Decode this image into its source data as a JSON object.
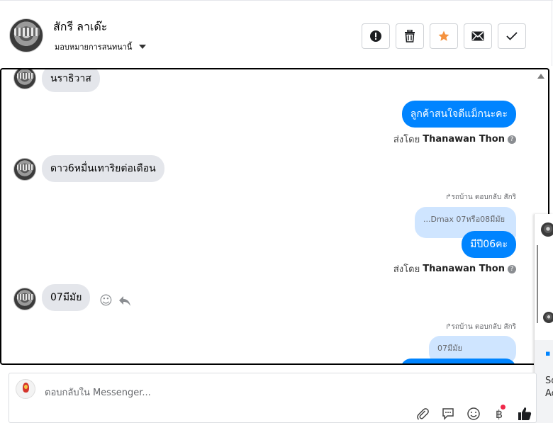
{
  "header": {
    "name": "สักรี ลาเด๊ะ",
    "assign_label": "มอบหมายการสนทนานี้",
    "actions": [
      "spam",
      "delete",
      "star",
      "unread",
      "done"
    ]
  },
  "conversation": {
    "messages": [
      {
        "dir": "in",
        "text": "นราธิวาส"
      },
      {
        "dir": "out",
        "text": "ลูกค้าสนใจดีแม็กนะคะ"
      },
      {
        "dir": "meta",
        "sent_by_prefix": "ส่งโดย",
        "sent_by_name": "Thanawan Thon"
      },
      {
        "dir": "in",
        "text": "ดาว6หมื่นเทาริยต่อเดือน"
      },
      {
        "dir": "reply_note",
        "text": "รถบ้าน ตอบกลับ สักริ"
      },
      {
        "dir": "reply_quote",
        "text": "...Dmax 07หรือ08มีมัย"
      },
      {
        "dir": "out",
        "text": "มีปี06คะ"
      },
      {
        "dir": "meta",
        "sent_by_prefix": "ส่งโดย",
        "sent_by_name": "Thanawan Thon"
      },
      {
        "dir": "in",
        "text": "07มีมัย"
      },
      {
        "dir": "reply_note",
        "text": "รถบ้าน ตอบกลับ สักริ"
      },
      {
        "dir": "reply_quote",
        "text": "07มีมัย"
      }
    ]
  },
  "peek": {
    "lines": [
      "So",
      "Ac"
    ]
  },
  "composer": {
    "placeholder": "ตอบกลับใน Messenger...",
    "tools": [
      "attach",
      "saved-reply",
      "emoji",
      "payment",
      "like"
    ]
  },
  "colors": {
    "accent": "#0084ff",
    "incoming": "#e4e6eb",
    "reply_quote": "#cfe5ff",
    "star": "#f5923e"
  }
}
